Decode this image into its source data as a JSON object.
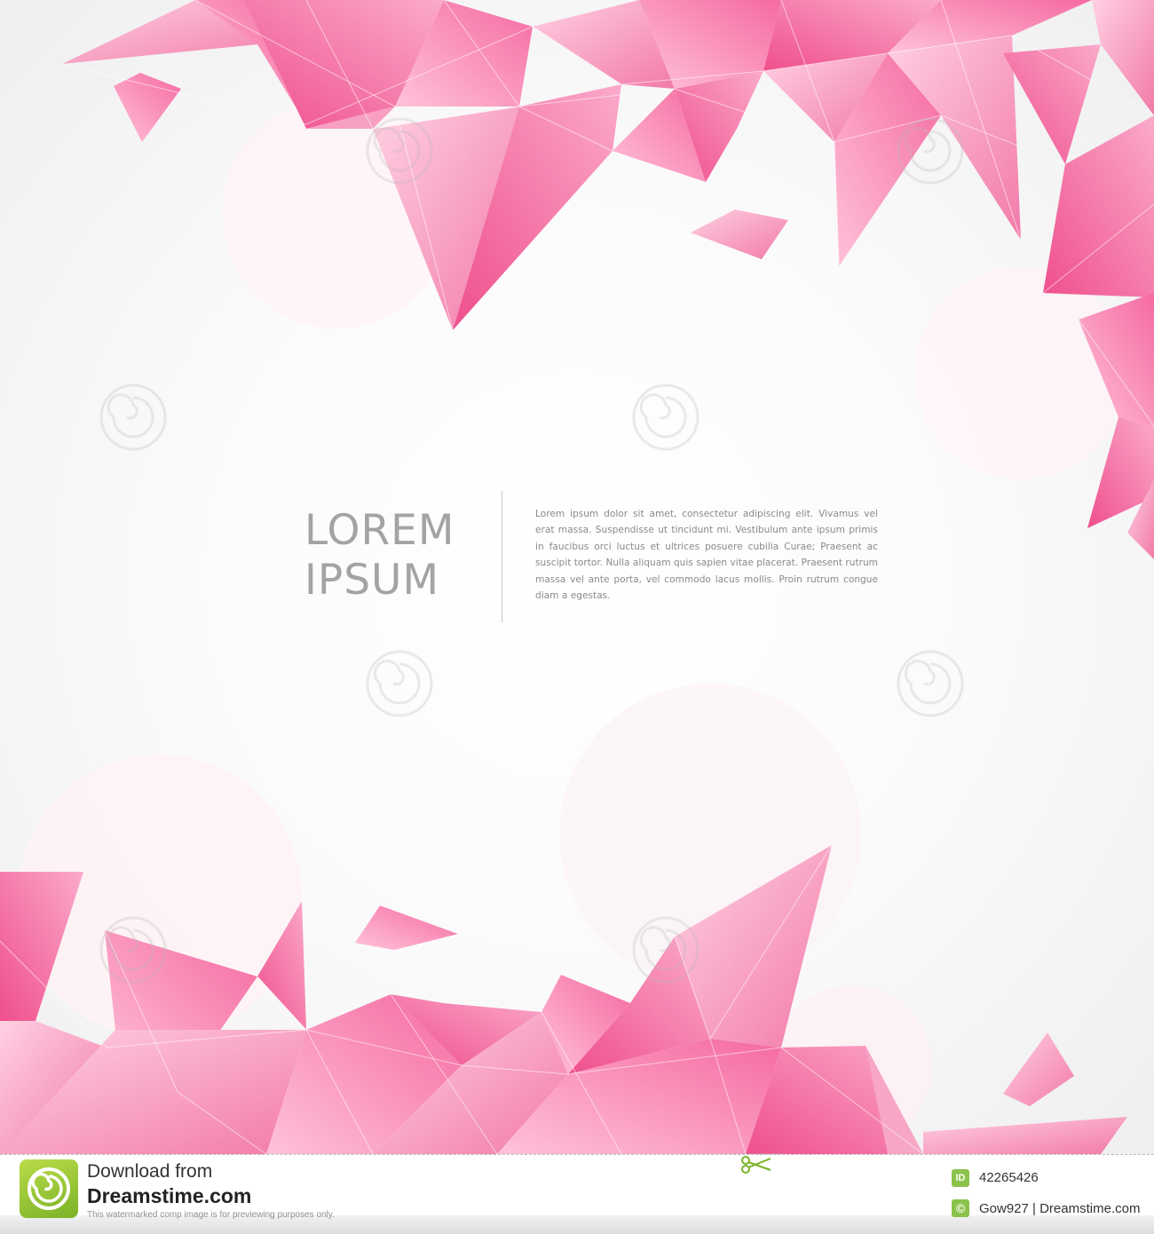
{
  "headline": {
    "line1": "LOREM",
    "line2": "IPSUM"
  },
  "body_copy": "Lorem ipsum dolor sit amet, consectetur adipiscing elit. Vivamus vel erat massa. Suspendisse ut tincidunt mi. Vestibulum ante ipsum primis in faucibus orci luctus et ultrices posuere cubilia Curae; Praesent ac suscipit tortor. Nulla aliquam quis sapien vitae placerat. Praesent rutrum massa vel ante porta, vel commodo lacus mollis. Proin rutrum congue diam a egestas.",
  "colors": {
    "crystal_light": "#ffc4dc",
    "crystal_mid": "#f98bb6",
    "crystal_dark": "#ef4f8d",
    "headline_text": "#a3a3a3",
    "body_text": "#8a8a8a",
    "badge_green": "#8bc34a"
  },
  "footer": {
    "download_label": "Download from",
    "brand": "Dreamstime.com",
    "notice": "This watermarked comp image is for previewing purposes only.",
    "id_badge": "ID",
    "image_id": "42265426",
    "copyright_badge": "©",
    "credit": "Gow927 | Dreamstime.com",
    "logo_icon": "dreamstime-swirl-icon",
    "scissors_icon": "scissors-icon"
  }
}
